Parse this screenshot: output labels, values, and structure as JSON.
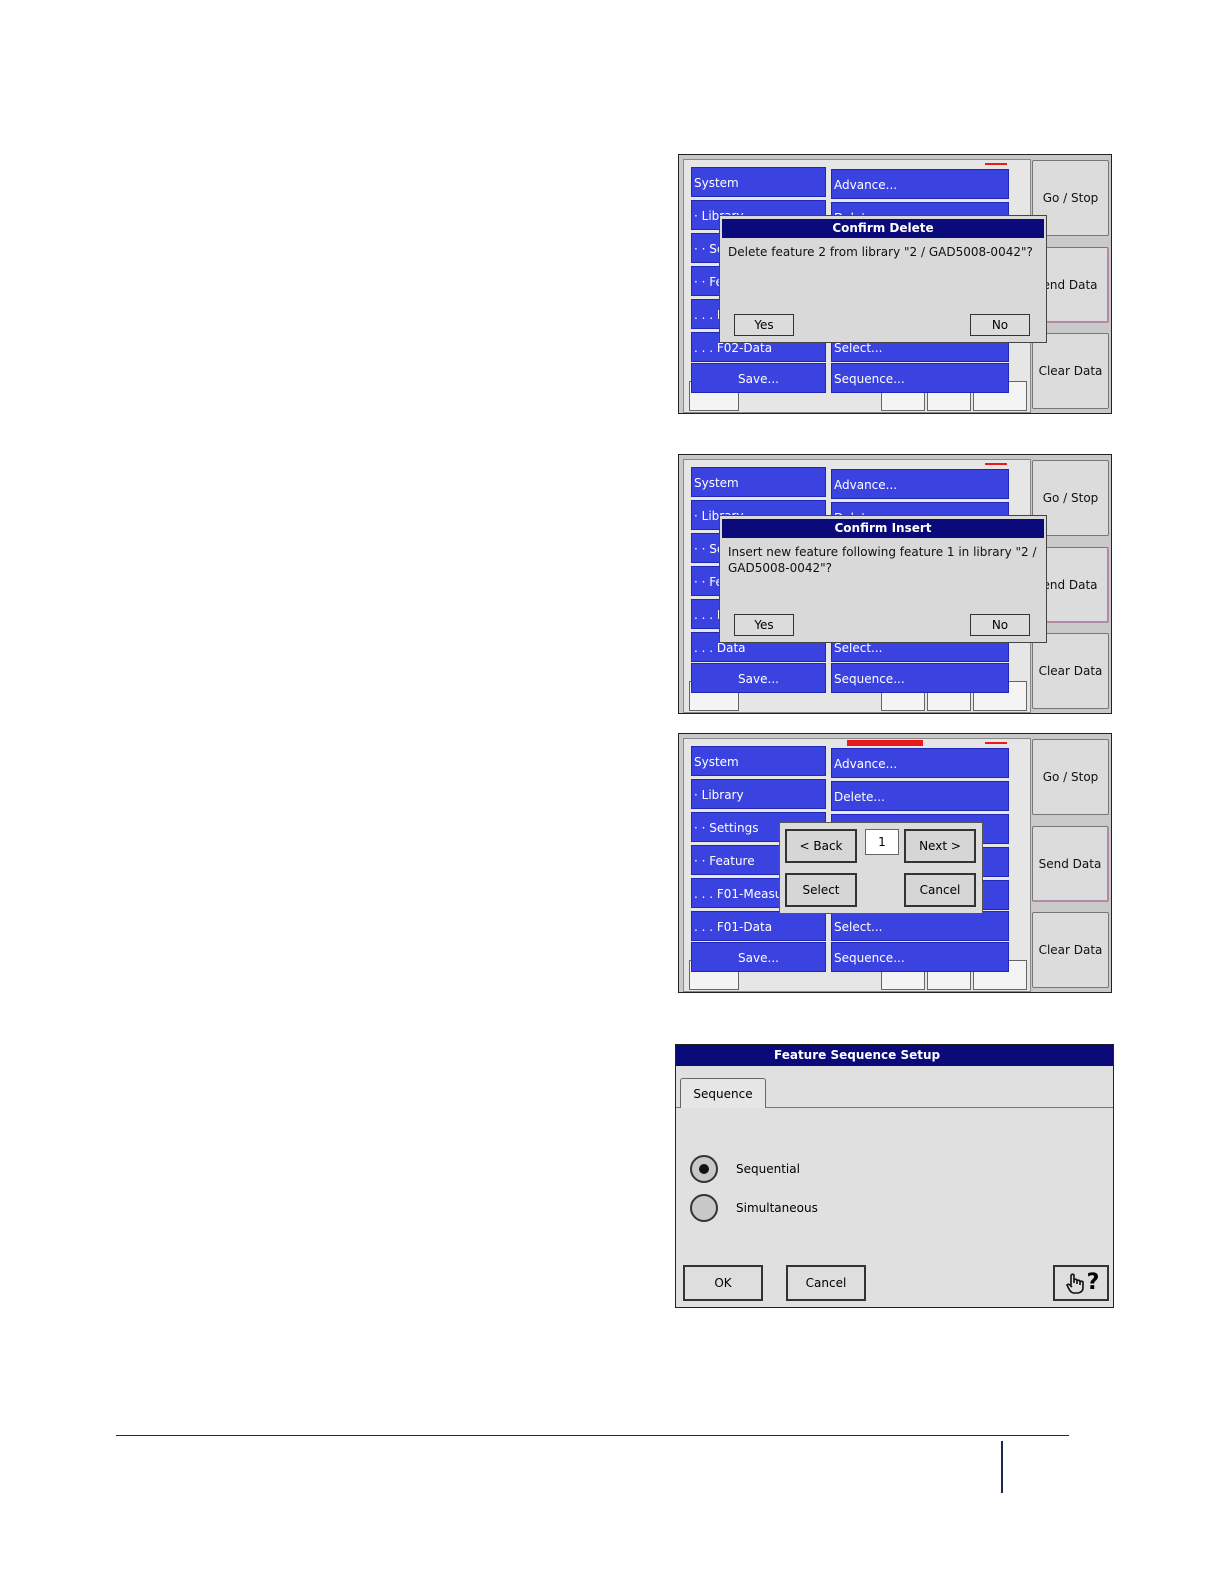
{
  "screens": [
    {
      "left_menu": [
        "System",
        "· Library",
        "· · Se",
        "· · Fe",
        ". . . F",
        ". . . F02-Data",
        "Save..."
      ],
      "right_menu": [
        "Advance...",
        "Delete...",
        "Select...",
        "Sequence..."
      ],
      "side_buttons": [
        "Go / Stop",
        "end Data",
        "Clear Data"
      ],
      "dialog": {
        "title": "Confirm Delete",
        "message": "Delete feature 2 from library \"2 / GAD5008-0042\"?",
        "yes": "Yes",
        "no": "No"
      }
    },
    {
      "left_menu": [
        "System",
        "· Library",
        "· · Se",
        "· · Fe",
        ". . . M",
        ". . . Data",
        "Save..."
      ],
      "right_menu": [
        "Advance...",
        "Delete...",
        "Select...",
        "Sequence..."
      ],
      "side_buttons": [
        "Go / Stop",
        "end Data",
        "Clear Data"
      ],
      "dialog": {
        "title": "Confirm Insert",
        "message": "Insert new feature following feature 1 in library \"2 / GAD5008-0042\"?",
        "yes": "Yes",
        "no": "No"
      }
    },
    {
      "left_menu": [
        "System",
        "· Library",
        "· · Settings",
        "· · Feature",
        ". . . F01-Measu",
        ". . . F01-Data",
        "Save..."
      ],
      "right_menu": [
        "Advance...",
        "Delete...",
        "Select...",
        "Sequence..."
      ],
      "side_buttons": [
        "Go / Stop",
        "Send Data",
        "Clear Data"
      ],
      "picker": {
        "back": "< Back",
        "value": "1",
        "next": "Next >",
        "select": "Select",
        "cancel": "Cancel"
      }
    }
  ],
  "setup": {
    "title": "Feature Sequence Setup",
    "tab": "Sequence",
    "options": [
      {
        "label": "Sequential",
        "selected": true
      },
      {
        "label": "Simultaneous",
        "selected": false
      }
    ],
    "ok": "OK",
    "cancel": "Cancel",
    "help": "?"
  },
  "colors": {
    "menu_blue": "#3a43e0",
    "title_navy": "#0a0a7a",
    "alert_red": "#e81a1a"
  }
}
